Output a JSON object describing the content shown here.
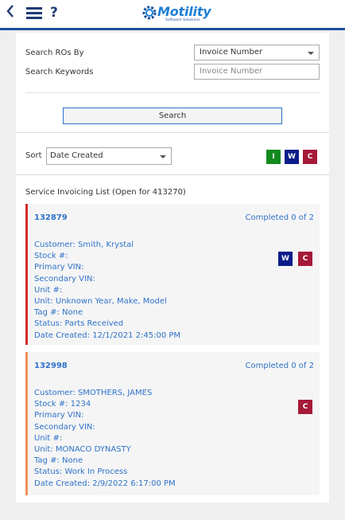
{
  "header": {
    "brand": "Motility",
    "brand_tagline": "Software Solutions",
    "back_icon": "chevron-left",
    "menu_icon": "hamburger",
    "help_label": "?"
  },
  "search": {
    "search_by_label": "Search ROs By",
    "search_by_value": "Invoice Number",
    "keywords_label": "Search Keywords",
    "keywords_placeholder": "Invoice Number",
    "button_label": "Search"
  },
  "sort": {
    "label": "Sort",
    "value": "Date Created",
    "filters": [
      {
        "label": "I",
        "color": "#138a1e"
      },
      {
        "label": "W",
        "color": "#0b1d8a"
      },
      {
        "label": "C",
        "color": "#a51a38"
      }
    ]
  },
  "list": {
    "title": "Service Invoicing List (Open for 413270)",
    "items": [
      {
        "ro": "132879",
        "status_summary": "Completed 0 of 2",
        "accent": "#d22a2a",
        "fields": [
          "Customer: Smith, Krystal",
          "Stock #:",
          "Primary VIN:",
          "Secondary VIN:",
          "Unit #:",
          "Unit: Unknown Year, Make, Model",
          "Tag #: None",
          "Status: Parts Received",
          "Date Created: 12/1/2021 2:45:00 PM"
        ],
        "badges": [
          "W",
          "C"
        ]
      },
      {
        "ro": "132998",
        "status_summary": "Completed 0 of 2",
        "accent": "#f4915a",
        "fields": [
          "Customer: SMOTHERS, JAMES",
          "Stock #: 1234",
          "Primary VIN:",
          "Secondary VIN:",
          "Unit #:",
          "Unit: MONACO DYNASTY",
          "Tag #: None",
          "Status: Work In Process",
          "Date Created: 2/9/2022 6:17:00 PM"
        ],
        "badges": [
          "C"
        ]
      }
    ]
  }
}
